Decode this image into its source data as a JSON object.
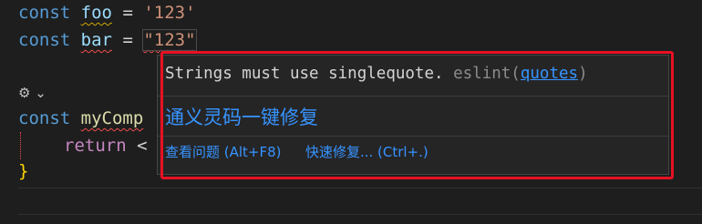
{
  "code": {
    "line1": {
      "kw": "const",
      "name": "foo",
      "op": "=",
      "value": "'123'"
    },
    "line2": {
      "kw": "const",
      "name": "bar",
      "op": "=",
      "value": "\"123\""
    },
    "line4": {
      "kw": "const",
      "name": "myComp"
    },
    "line5": {
      "kw": "return",
      "rest": "<"
    },
    "line6": {
      "brace": "}"
    }
  },
  "codelens": {
    "icon": "copilot-icon",
    "chevron": "chevron-down-icon"
  },
  "hover": {
    "message": "Strings must use singlequote.",
    "source_prefix": "eslint(",
    "rule": "quotes",
    "source_suffix": ")",
    "ai_fix": "通义灵码一键修复",
    "view_problem": "查看问题 (Alt+F8)",
    "quick_fix": "快速修复... (Ctrl+.)"
  },
  "colors": {
    "highlight": "#e81123",
    "link": "#3794ff"
  }
}
